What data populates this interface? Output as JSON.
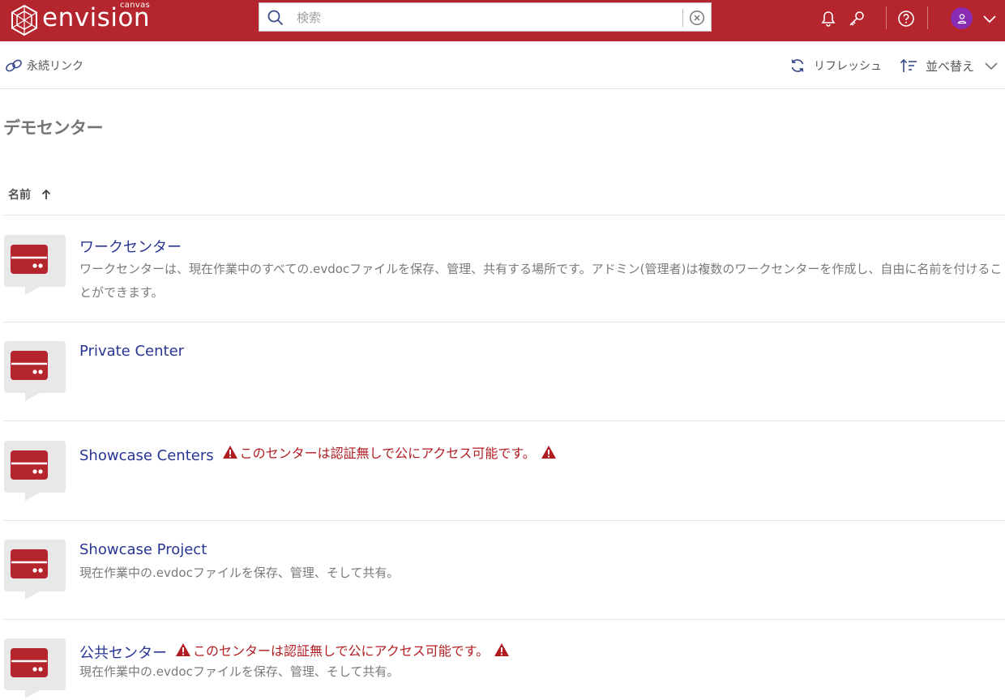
{
  "brand": {
    "name": "envision",
    "sub": "canvas"
  },
  "search": {
    "placeholder": "検索",
    "value": ""
  },
  "header_icons": [
    "bell-icon",
    "key-icon",
    "help-icon",
    "user-avatar",
    "chevron-down-icon"
  ],
  "toolbar": {
    "permalink_label": "永続リンク",
    "refresh_label": "リフレッシュ",
    "sort_label": "並べ替え"
  },
  "page": {
    "title": "デモセンター"
  },
  "list": {
    "column_name": "名前",
    "sort_direction": "ascending",
    "items": [
      {
        "title": "ワークセンター",
        "warning": "",
        "description": "ワークセンターは、現在作業中のすべての.evdocファイルを保存、管理、共有する場所です。アドミン(管理者)は複数のワークセンターを作成し、自由に名前を付けることができます。"
      },
      {
        "title": "Private Center",
        "warning": "",
        "description": ""
      },
      {
        "title": "Showcase Centers",
        "warning": "このセンターは認証無しで公にアクセス可能です。",
        "description": ""
      },
      {
        "title": "Showcase Project",
        "warning": "",
        "description": "現在作業中の.evdocファイルを保存、管理、そして共有。"
      },
      {
        "title": "公共センター",
        "warning": "このセンターは認証無しで公にアクセス可能です。",
        "description": "現在作業中の.evdocファイルを保存、管理、そして共有。"
      }
    ]
  },
  "colors": {
    "brand": "#b5252d",
    "link": "#283593",
    "warning": "#b01c22",
    "avatar": "#8a2bb3"
  }
}
